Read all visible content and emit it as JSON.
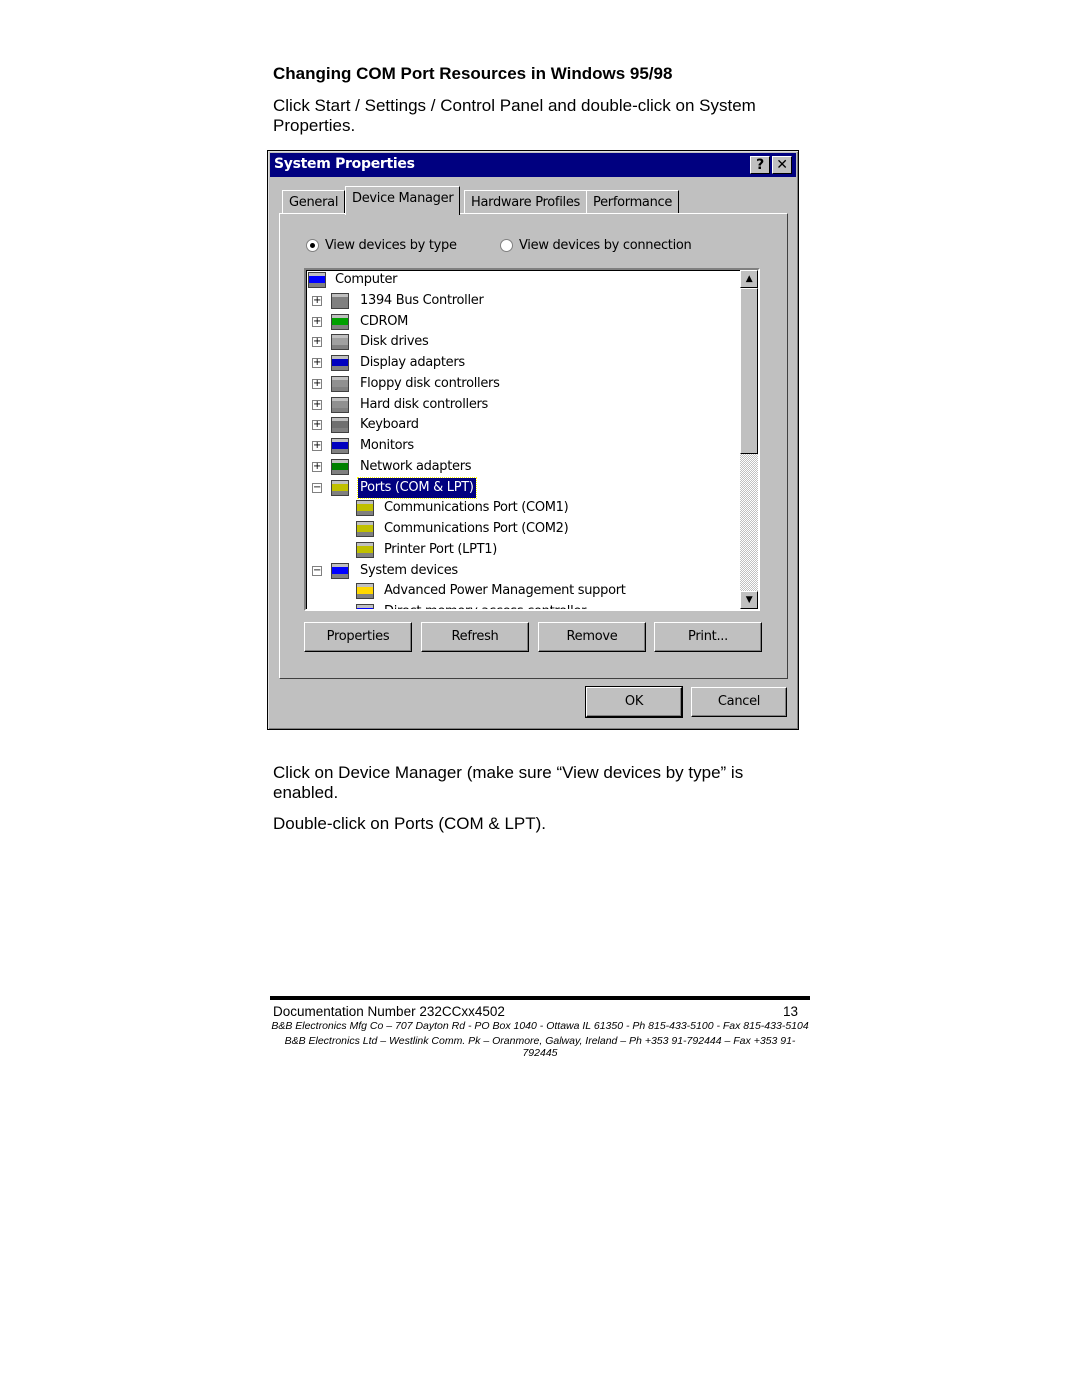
{
  "heading": "Changing COM Port Resources in Windows 95/98",
  "intro": "Click Start / Settings / Control Panel and double-click on System Properties.",
  "dialog": {
    "title": "System Properties",
    "help_button": "?",
    "close_button": "✕",
    "tabs": [
      {
        "label": "General"
      },
      {
        "label": "Device Manager",
        "active": true
      },
      {
        "label": "Hardware Profiles"
      },
      {
        "label": "Performance"
      }
    ],
    "radio_by_type": "View devices by type",
    "radio_by_connection": "View devices by connection",
    "selected_view": "by_type",
    "tree": [
      {
        "label": "Computer",
        "level": 0,
        "icon": "computer-icon"
      },
      {
        "label": "1394 Bus Controller",
        "level": 1,
        "expander": "+",
        "icon": "bus-controller-icon"
      },
      {
        "label": "CDROM",
        "level": 1,
        "expander": "+",
        "icon": "cdrom-icon"
      },
      {
        "label": "Disk drives",
        "level": 1,
        "expander": "+",
        "icon": "disk-drive-icon"
      },
      {
        "label": "Display adapters",
        "level": 1,
        "expander": "+",
        "icon": "display-icon"
      },
      {
        "label": "Floppy disk controllers",
        "level": 1,
        "expander": "+",
        "icon": "controller-icon"
      },
      {
        "label": "Hard disk controllers",
        "level": 1,
        "expander": "+",
        "icon": "controller-icon"
      },
      {
        "label": "Keyboard",
        "level": 1,
        "expander": "+",
        "icon": "keyboard-icon"
      },
      {
        "label": "Monitors",
        "level": 1,
        "expander": "+",
        "icon": "monitor-icon"
      },
      {
        "label": "Network adapters",
        "level": 1,
        "expander": "+",
        "icon": "network-adapter-icon"
      },
      {
        "label": "Ports (COM & LPT)",
        "level": 1,
        "expander": "−",
        "icon": "port-icon",
        "selected": true
      },
      {
        "label": "Communications Port (COM1)",
        "level": 2,
        "icon": "port-icon"
      },
      {
        "label": "Communications Port (COM2)",
        "level": 2,
        "icon": "port-icon"
      },
      {
        "label": "Printer Port (LPT1)",
        "level": 2,
        "icon": "port-icon"
      },
      {
        "label": "System devices",
        "level": 1,
        "expander": "−",
        "icon": "computer-icon"
      },
      {
        "label": "Advanced Power Management support",
        "level": 2,
        "icon": "warning-device-icon"
      },
      {
        "label": "Direct memory access controller",
        "level": 2,
        "icon": "computer-icon"
      }
    ],
    "buttons": {
      "properties": "Properties",
      "refresh": "Refresh",
      "remove": "Remove",
      "print": "Print...",
      "ok": "OK",
      "cancel": "Cancel"
    },
    "colors": {
      "titlebar": "#000080",
      "face": "#c0c0c0",
      "selection": "#000080"
    }
  },
  "after_1": "Click on Device Manager (make sure “View devices by type” is enabled.",
  "after_2": "Double-click on Ports (COM & LPT).",
  "footer": {
    "doc_number": "Documentation Number 232CCxx4502",
    "page": "13",
    "line1": "B&B Electronics Mfg Co – 707 Dayton Rd - PO Box 1040 - Ottawa IL 61350 - Ph 815-433-5100 - Fax 815-433-5104",
    "line2": "B&B Electronics Ltd – Westlink Comm. Pk – Oranmore, Galway, Ireland – Ph +353 91-792444 – Fax +353 91-792445"
  }
}
